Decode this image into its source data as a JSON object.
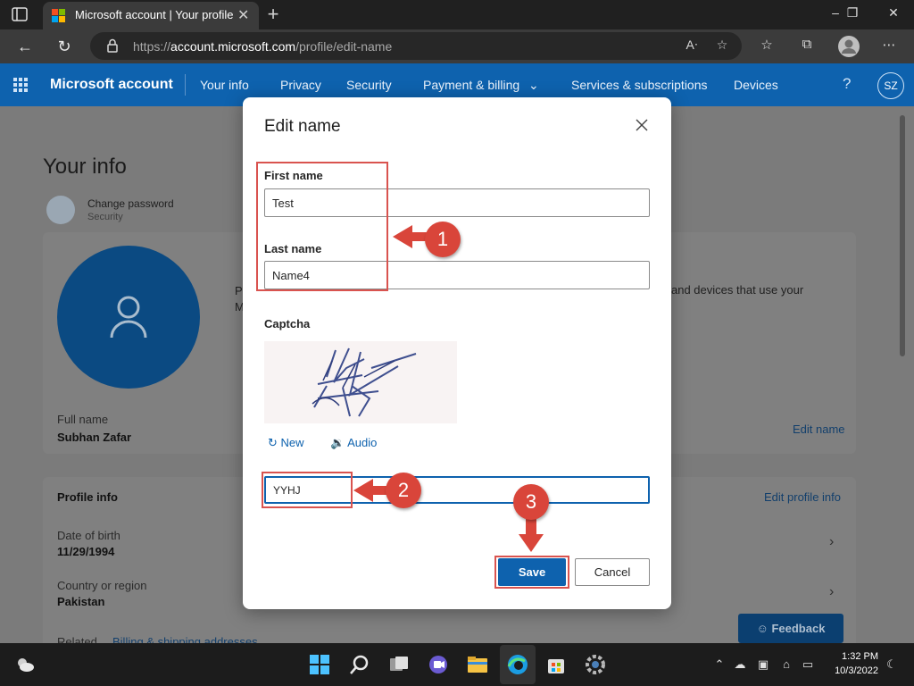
{
  "browser": {
    "tab_title": "Microsoft account | Your profile",
    "url_prefix": "https://",
    "url_host": "account.microsoft.com",
    "url_path": "/profile/edit-name",
    "window_controls": [
      "–",
      "❐",
      "✕"
    ]
  },
  "header": {
    "brand": "Microsoft account",
    "nav": [
      "Your info",
      "Privacy",
      "Security",
      "Payment & billing",
      "Services & subscriptions",
      "Devices"
    ],
    "help": "?",
    "avatar_initials": "SZ"
  },
  "page": {
    "title": "Your info",
    "change_password": "Change password",
    "change_password_sub": "Security",
    "partial_left_1": "P",
    "partial_left_2": "M",
    "partial_right": "and devices that use your",
    "full_name_label": "Full name",
    "full_name_value": "Subhan Zafar",
    "edit_name_link": "Edit name",
    "profile_info_title": "Profile info",
    "edit_profile_link": "Edit profile info",
    "dob_label": "Date of birth",
    "dob_value": "11/29/1994",
    "country_label": "Country or region",
    "country_value": "Pakistan",
    "related_label": "Related",
    "related_link": "Billing & shipping addresses",
    "feedback": "Feedback"
  },
  "dialog": {
    "title": "Edit name",
    "first_name_label": "First name",
    "first_name_value": "Test",
    "last_name_label": "Last name",
    "last_name_value": "Name4",
    "captcha_label": "Captcha",
    "new_label": "New",
    "audio_label": "Audio",
    "captcha_value": "YYHJ",
    "save_label": "Save",
    "cancel_label": "Cancel"
  },
  "annotations": [
    "1",
    "2",
    "3"
  ],
  "colors": {
    "accent": "#0e62ae",
    "annotation": "#d9453a"
  },
  "taskbar": {
    "time": "1:32 PM",
    "date": "10/3/2022"
  }
}
